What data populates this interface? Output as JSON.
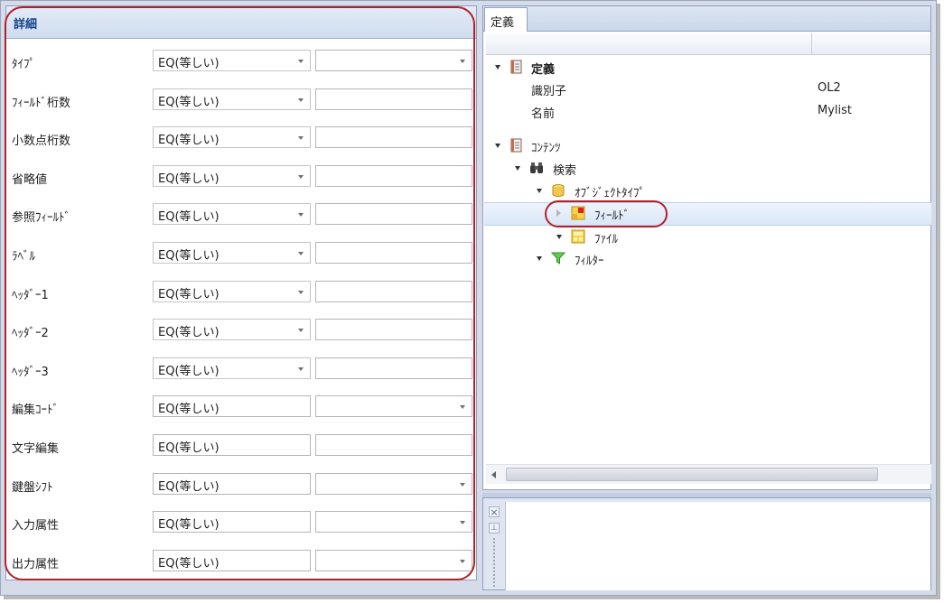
{
  "left_panel": {
    "title": "詳細",
    "rows": [
      {
        "label": "ﾀｲﾌﾟ",
        "operator": "EQ(等しい)",
        "value": "",
        "operator_is_dropdown": true,
        "value_is_dropdown": true
      },
      {
        "label": "ﾌｨｰﾙﾄﾞ桁数",
        "operator": "EQ(等しい)",
        "value": "",
        "operator_is_dropdown": true,
        "value_is_dropdown": false
      },
      {
        "label": "小数点桁数",
        "operator": "EQ(等しい)",
        "value": "",
        "operator_is_dropdown": true,
        "value_is_dropdown": false
      },
      {
        "label": "省略値",
        "operator": "EQ(等しい)",
        "value": "",
        "operator_is_dropdown": true,
        "value_is_dropdown": false
      },
      {
        "label": "参照ﾌｨｰﾙﾄﾞ",
        "operator": "EQ(等しい)",
        "value": "",
        "operator_is_dropdown": true,
        "value_is_dropdown": false
      },
      {
        "label": "ﾗﾍﾞﾙ",
        "operator": "EQ(等しい)",
        "value": "",
        "operator_is_dropdown": true,
        "value_is_dropdown": false
      },
      {
        "label": "ﾍｯﾀﾞｰ1",
        "operator": "EQ(等しい)",
        "value": "",
        "operator_is_dropdown": true,
        "value_is_dropdown": false
      },
      {
        "label": "ﾍｯﾀﾞｰ2",
        "operator": "EQ(等しい)",
        "value": "",
        "operator_is_dropdown": true,
        "value_is_dropdown": false
      },
      {
        "label": "ﾍｯﾀﾞｰ3",
        "operator": "EQ(等しい)",
        "value": "",
        "operator_is_dropdown": true,
        "value_is_dropdown": false
      },
      {
        "label": "編集ｺｰﾄﾞ",
        "operator": "EQ(等しい)",
        "value": "",
        "operator_is_dropdown": false,
        "value_is_dropdown": true
      },
      {
        "label": "文字編集",
        "operator": "EQ(等しい)",
        "value": "",
        "operator_is_dropdown": false,
        "value_is_dropdown": false
      },
      {
        "label": "鍵盤ｼﾌﾄ",
        "operator": "EQ(等しい)",
        "value": "",
        "operator_is_dropdown": false,
        "value_is_dropdown": true
      },
      {
        "label": "入力属性",
        "operator": "EQ(等しい)",
        "value": "",
        "operator_is_dropdown": false,
        "value_is_dropdown": true
      },
      {
        "label": "出力属性",
        "operator": "EQ(等しい)",
        "value": "",
        "operator_is_dropdown": false,
        "value_is_dropdown": true
      }
    ]
  },
  "right_panel": {
    "tab_label": "定義",
    "tree": {
      "definition": {
        "label": "定義",
        "identifier_key": "識別子",
        "identifier_value": "OL2",
        "name_key": "名前",
        "name_value": "Mylist"
      },
      "contents": {
        "label": "ｺﾝﾃﾝﾂ"
      },
      "search": {
        "label": "検索"
      },
      "object_type": {
        "label": "ｵﾌﾞｼﾞｪｸﾄﾀｲﾌﾟ"
      },
      "field": {
        "label": "ﾌｨｰﾙﾄﾞ"
      },
      "file": {
        "label": "ﾌｧｲﾙ"
      },
      "filter": {
        "label": "ﾌｨﾙﾀｰ"
      }
    }
  },
  "dock": {
    "close_glyph": "×",
    "pin_glyph": "⊥"
  },
  "colors": {
    "highlight_circle": "#b4202a",
    "header_text": "#15428b",
    "selection": "#d9e7f8"
  }
}
